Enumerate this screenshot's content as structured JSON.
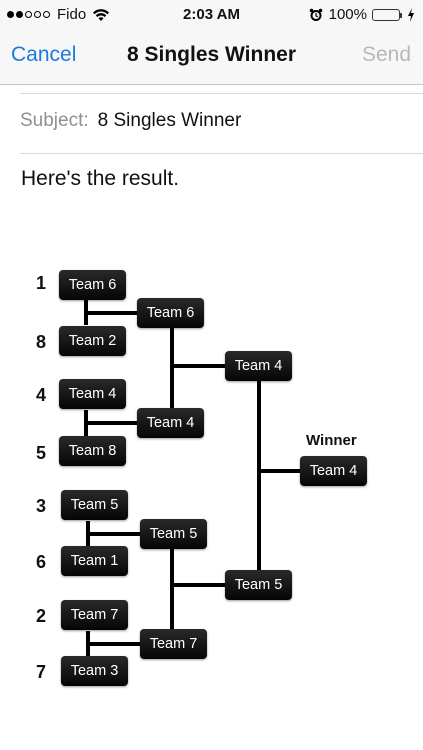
{
  "status_bar": {
    "carrier": "Fido",
    "time": "2:03 AM",
    "battery": "100%",
    "battery_color": "#4cd964"
  },
  "nav": {
    "cancel_label": "Cancel",
    "title": "8 Singles Winner",
    "send_label": "Send",
    "accent_color": "#1a7ae0"
  },
  "mail": {
    "subject_label": "Subject:",
    "subject_value": "8 Singles Winner",
    "body": "Here's the result."
  },
  "bracket": {
    "winner_label": "Winner",
    "seeds": [
      "1",
      "8",
      "4",
      "5",
      "3",
      "6",
      "2",
      "7"
    ],
    "round1": [
      "Team 6",
      "Team 2",
      "Team 4",
      "Team 8",
      "Team 5",
      "Team 1",
      "Team 7",
      "Team 3"
    ],
    "round2": [
      "Team 6",
      "Team 4",
      "Team 5",
      "Team 7"
    ],
    "round3": [
      "Team 4",
      "Team 5"
    ],
    "winner": "Team 4"
  }
}
